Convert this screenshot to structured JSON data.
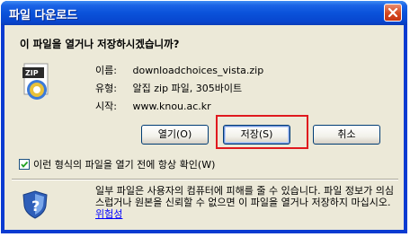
{
  "window": {
    "title": "파일 다운로드"
  },
  "dialog": {
    "question": "이 파일을 열거나 저장하시겠습니까?",
    "file_info": [
      {
        "label": "이름:",
        "value": "downloadchoices_vista.zip"
      },
      {
        "label": "유형:",
        "value": "알집 zip 파일, 305바이트"
      },
      {
        "label": "시작:",
        "value": "www.knou.ac.kr"
      }
    ],
    "buttons": {
      "open_label": "열기(O)",
      "save_label": "저장(S)",
      "cancel_label": "취소"
    },
    "always_ask_checkbox": {
      "label": "이런 형식의 파일을 열기 전에 항상 확인(W)",
      "checked": true
    },
    "warning_text": "일부 파일은 사용자의 컴퓨터에 피해를 줄 수 있습니다. 파일 정보가 의심스럽거나 원본을 신뢰할 수 없으면 이 파일을 열거나 저장하지 마십시오.",
    "risk_link": "위험성"
  },
  "icons": {
    "file": "zip-file-icon",
    "security": "shield-icon",
    "close": "close-icon"
  },
  "colors": {
    "titlebar": "#0a52da",
    "dialog_bg": "#ece9d8",
    "highlight": "#e0191e",
    "link": "#0000ff"
  }
}
